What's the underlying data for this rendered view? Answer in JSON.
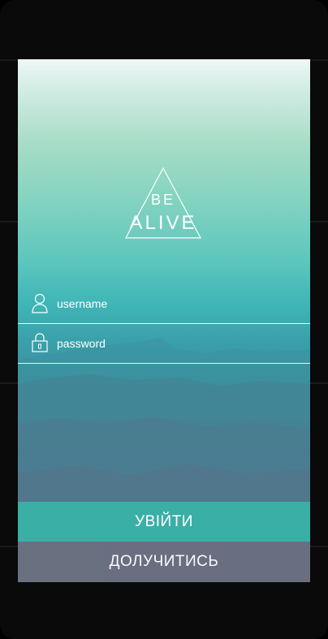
{
  "logo": {
    "line1": "BE",
    "line2": "ALIVE"
  },
  "form": {
    "username_placeholder": "username",
    "password_placeholder": "password"
  },
  "buttons": {
    "login_label": "УВІЙТИ",
    "join_label": "ДОЛУЧИТИСЬ"
  },
  "colors": {
    "accent": "#39afa6",
    "secondary_button": "#6a6f80",
    "text": "#ffffff"
  },
  "icons": {
    "username": "user-icon",
    "password": "lock-icon"
  }
}
